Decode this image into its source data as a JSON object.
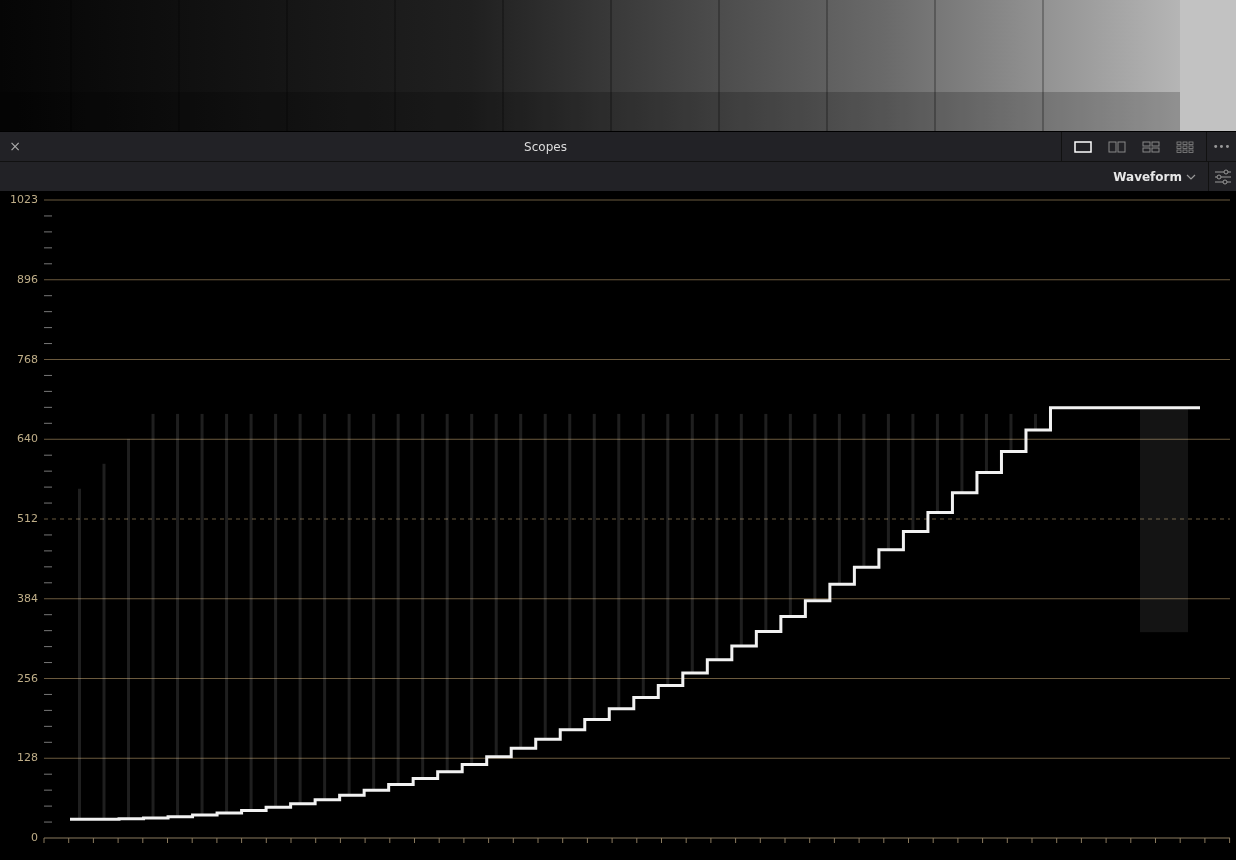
{
  "panel": {
    "title": "Scopes",
    "close": "×",
    "more": "•••"
  },
  "layouts": [
    {
      "selected": true
    },
    {
      "selected": false
    },
    {
      "selected": false
    },
    {
      "selected": false
    }
  ],
  "scope_type": {
    "label": "Waveform"
  },
  "y_axis": [
    {
      "label": "1023",
      "kind": "solid"
    },
    {
      "label": "896",
      "kind": "solid"
    },
    {
      "label": "768",
      "kind": "solid"
    },
    {
      "label": "640",
      "kind": "solid"
    },
    {
      "label": "512",
      "kind": "dashed"
    },
    {
      "label": "384",
      "kind": "solid"
    },
    {
      "label": "256",
      "kind": "solid"
    },
    {
      "label": "128",
      "kind": "solid"
    },
    {
      "label": "0",
      "kind": "axis"
    }
  ]
}
